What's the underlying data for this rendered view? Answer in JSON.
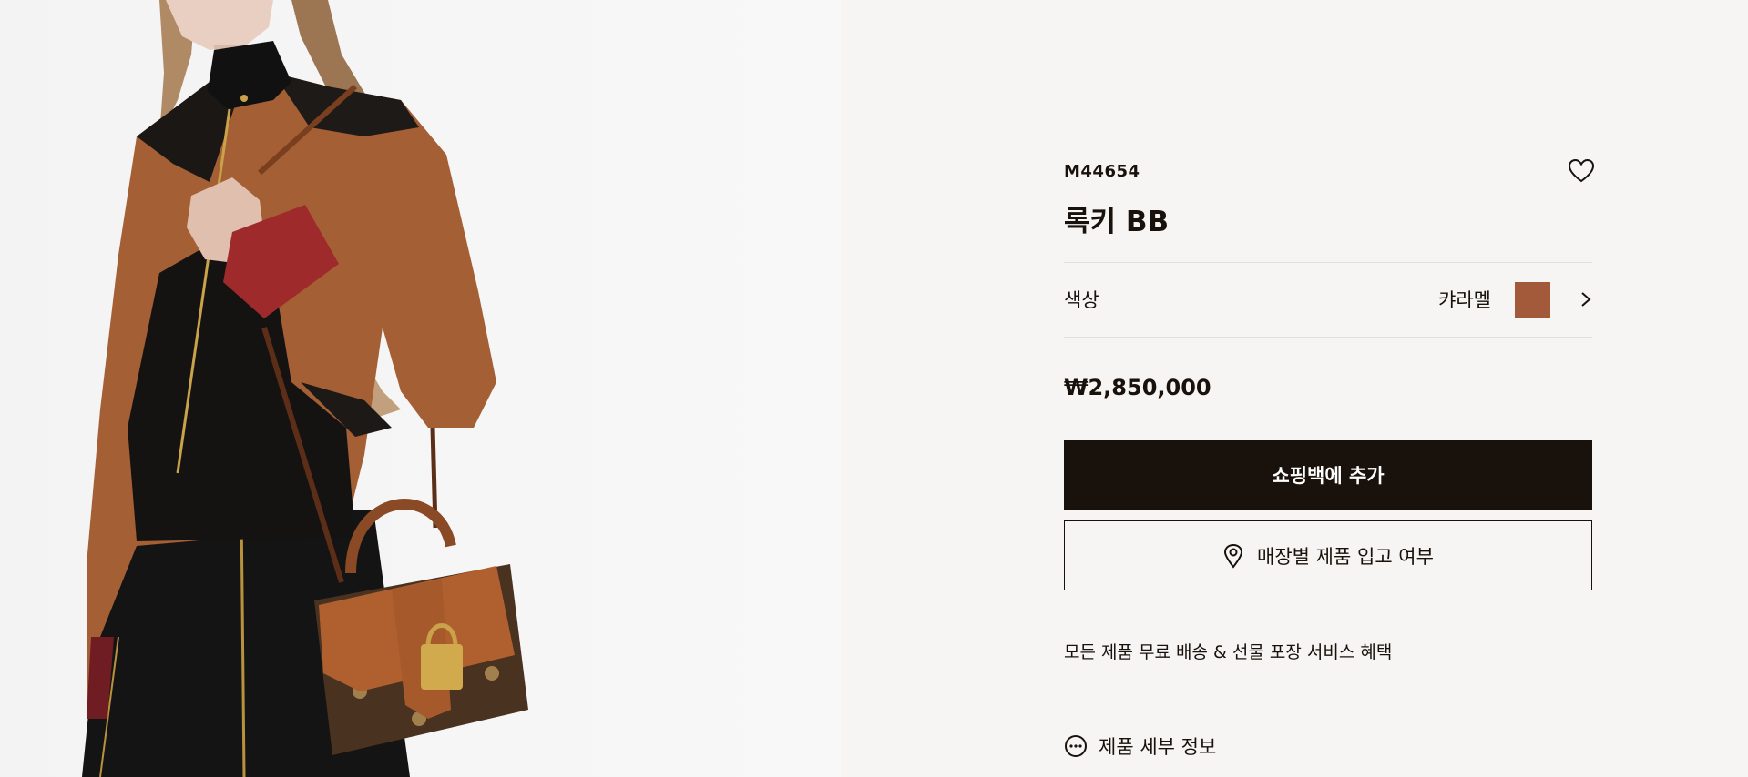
{
  "product": {
    "sku": "M44654",
    "title": "록키 BB",
    "color_label": "색상",
    "color_value": "캬라멜",
    "color_swatch": "#a35a3a",
    "price": "₩2,850,000"
  },
  "actions": {
    "add_to_bag": "쇼핑백에 추가",
    "store_availability": "매장별 제품 입고 여부"
  },
  "benefit_text": "모든 제품 무료 배송 & 선물 포장 서비스 혜택",
  "details_label": "제품 세부 정보",
  "icons": {
    "wishlist": "heart-icon",
    "color_more": "chevron-right-icon",
    "store": "location-pin-icon",
    "details": "more-dots-icon"
  },
  "colors": {
    "accent": "#19110b",
    "background": "#f6f5f3",
    "divider": "#e1dfdc"
  }
}
